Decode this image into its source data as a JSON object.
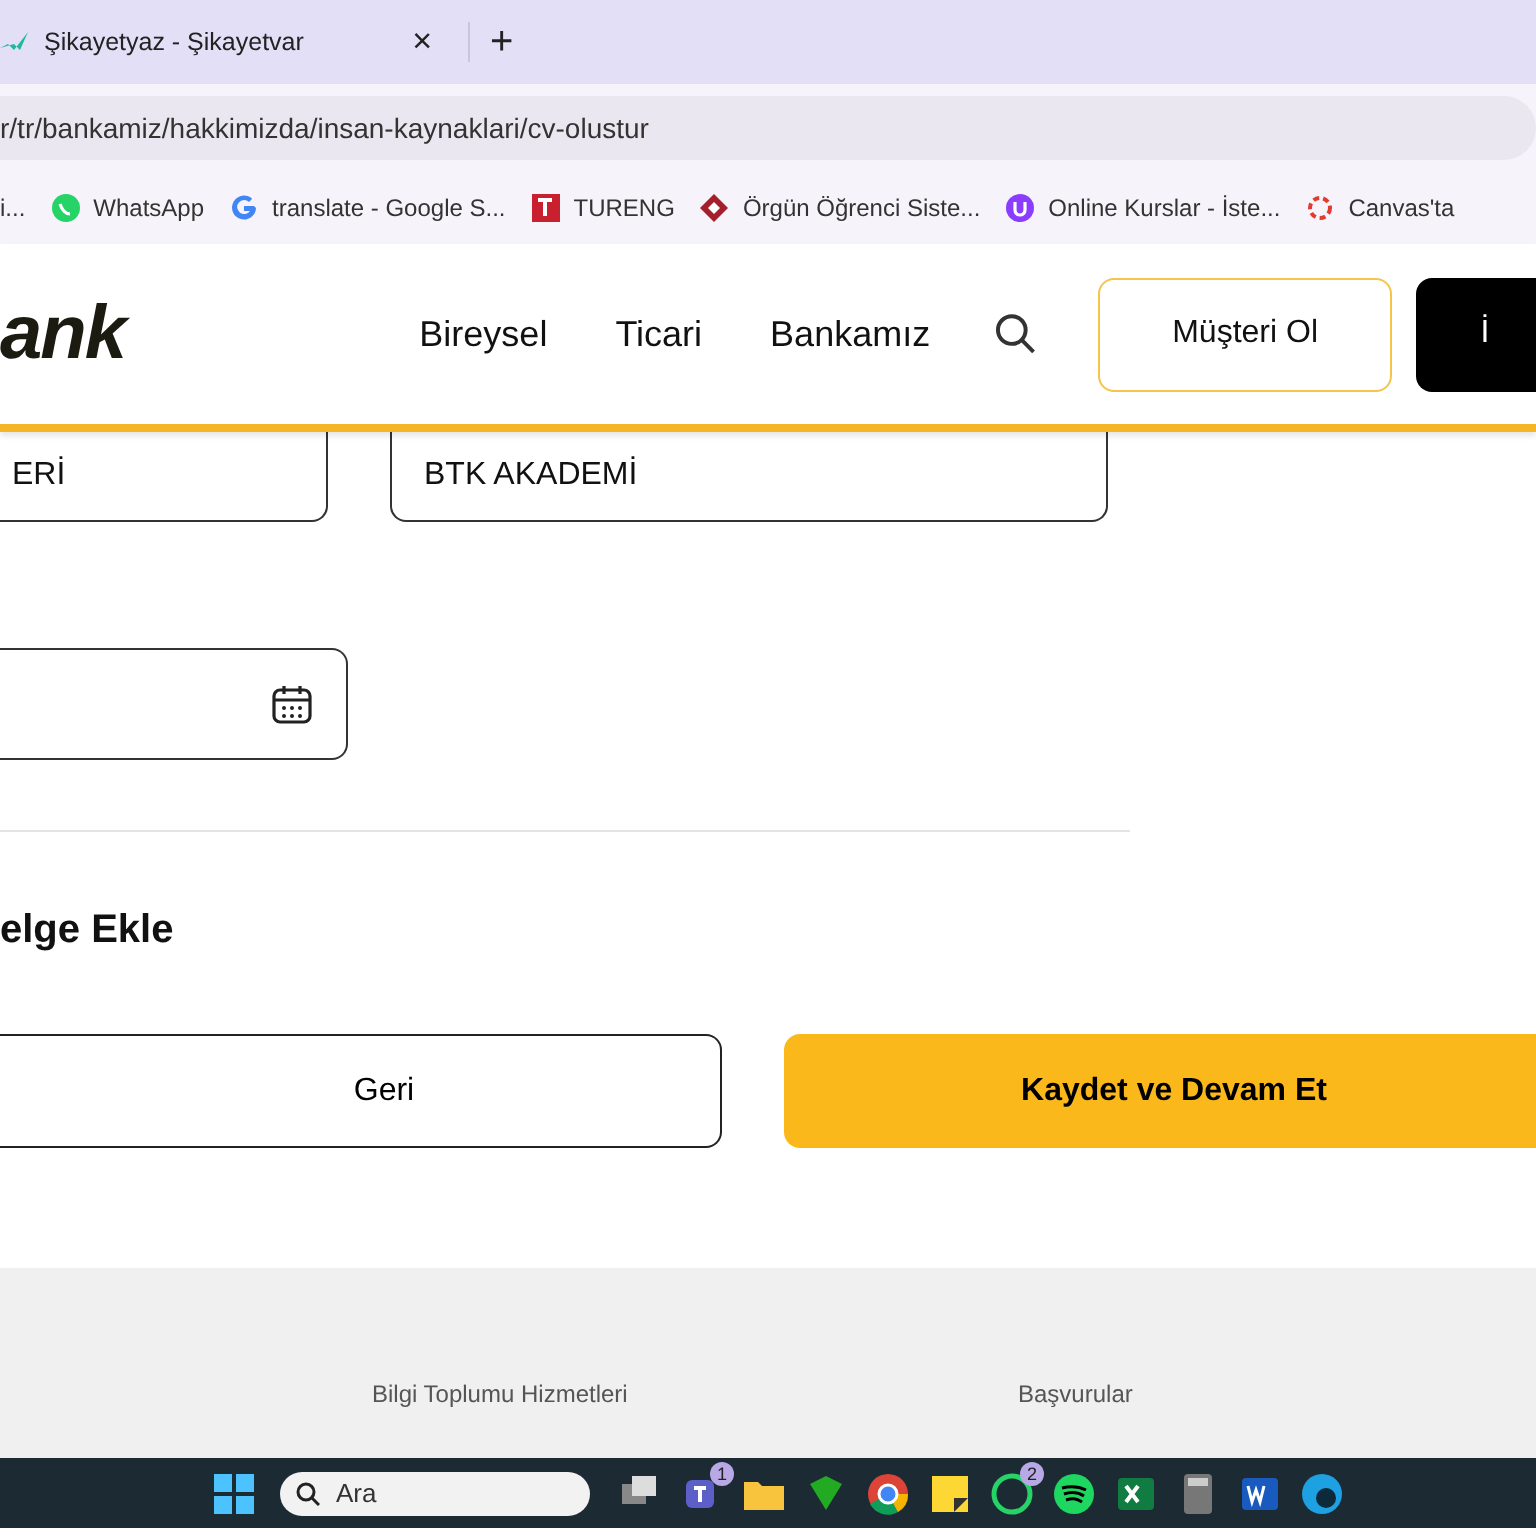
{
  "browser": {
    "tab": {
      "title": "Şikayetyaz - Şikayetvar",
      "close": "×"
    },
    "new_tab": "+",
    "url": "r/tr/bankamiz/hakkimizda/insan-kaynaklari/cv-olustur",
    "bookmarks": [
      {
        "label": "i...",
        "kind": "plain"
      },
      {
        "label": "WhatsApp",
        "kind": "whatsapp"
      },
      {
        "label": "translate - Google S...",
        "kind": "google"
      },
      {
        "label": "TURENG",
        "kind": "tureng"
      },
      {
        "label": "Örgün Öğrenci Siste...",
        "kind": "diamond"
      },
      {
        "label": "Online Kurslar - İste...",
        "kind": "purple"
      },
      {
        "label": "Canvas'ta",
        "kind": "canvas"
      }
    ]
  },
  "site": {
    "logo": "ank",
    "nav": [
      {
        "label": "Bireysel"
      },
      {
        "label": "Ticari"
      },
      {
        "label": "Bankamız"
      }
    ],
    "cta": "Müşteri Ol",
    "login": "İ"
  },
  "form": {
    "fields": [
      {
        "value": "ERİ"
      },
      {
        "value": "BTK AKADEMİ"
      }
    ],
    "date_field": {
      "kind": "date"
    },
    "section_title": "elge Ekle",
    "back": "Geri",
    "submit": "Kaydet ve Devam Et"
  },
  "footer": {
    "links": [
      "Bilgi Toplumu Hizmetleri",
      "Başvurular"
    ]
  },
  "taskbar": {
    "search": "Ara",
    "apps": [
      {
        "kind": "taskview"
      },
      {
        "kind": "teams",
        "badge": "1"
      },
      {
        "kind": "folder"
      },
      {
        "kind": "shield"
      },
      {
        "kind": "chrome"
      },
      {
        "kind": "notes"
      },
      {
        "kind": "whatsapp",
        "badge": "2"
      },
      {
        "kind": "spotify"
      },
      {
        "kind": "excel"
      },
      {
        "kind": "calc"
      },
      {
        "kind": "word"
      },
      {
        "kind": "edge"
      }
    ]
  }
}
